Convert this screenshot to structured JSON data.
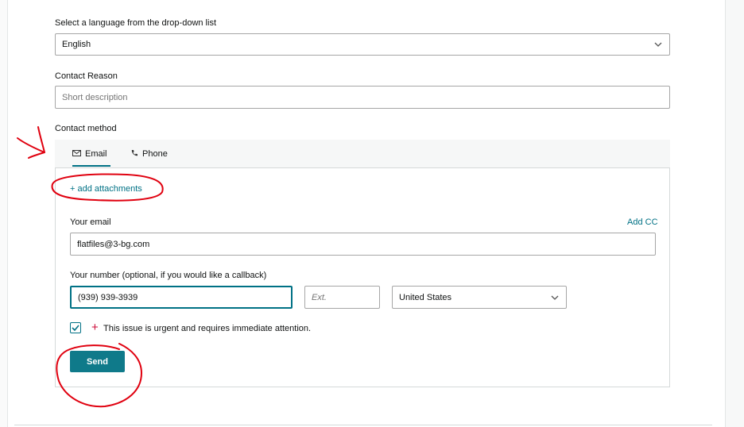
{
  "language": {
    "label": "Select a language from the drop-down list",
    "selected": "English"
  },
  "contact_reason": {
    "label": "Contact Reason",
    "placeholder": "Short description"
  },
  "contact_method": {
    "label": "Contact method",
    "tabs": [
      {
        "label": "Email",
        "icon": "envelope-icon",
        "active": true
      },
      {
        "label": "Phone",
        "icon": "phone-icon",
        "active": false
      }
    ]
  },
  "attachments": {
    "label": "+ add attachments"
  },
  "email": {
    "label": "Your email",
    "value": "flatfiles@3-bg.com",
    "add_cc": "Add CC"
  },
  "phone": {
    "label": "Your number (optional, if you would like a callback)",
    "value": "(939) 939-3939",
    "ext_placeholder": "Ext.",
    "country": "United States"
  },
  "urgent": {
    "checked": true,
    "text": "This issue is urgent and requires immediate attention."
  },
  "send": {
    "label": "Send"
  },
  "colors": {
    "accent": "#007185",
    "button": "#0f7a8a",
    "annotation": "#e0000f"
  }
}
